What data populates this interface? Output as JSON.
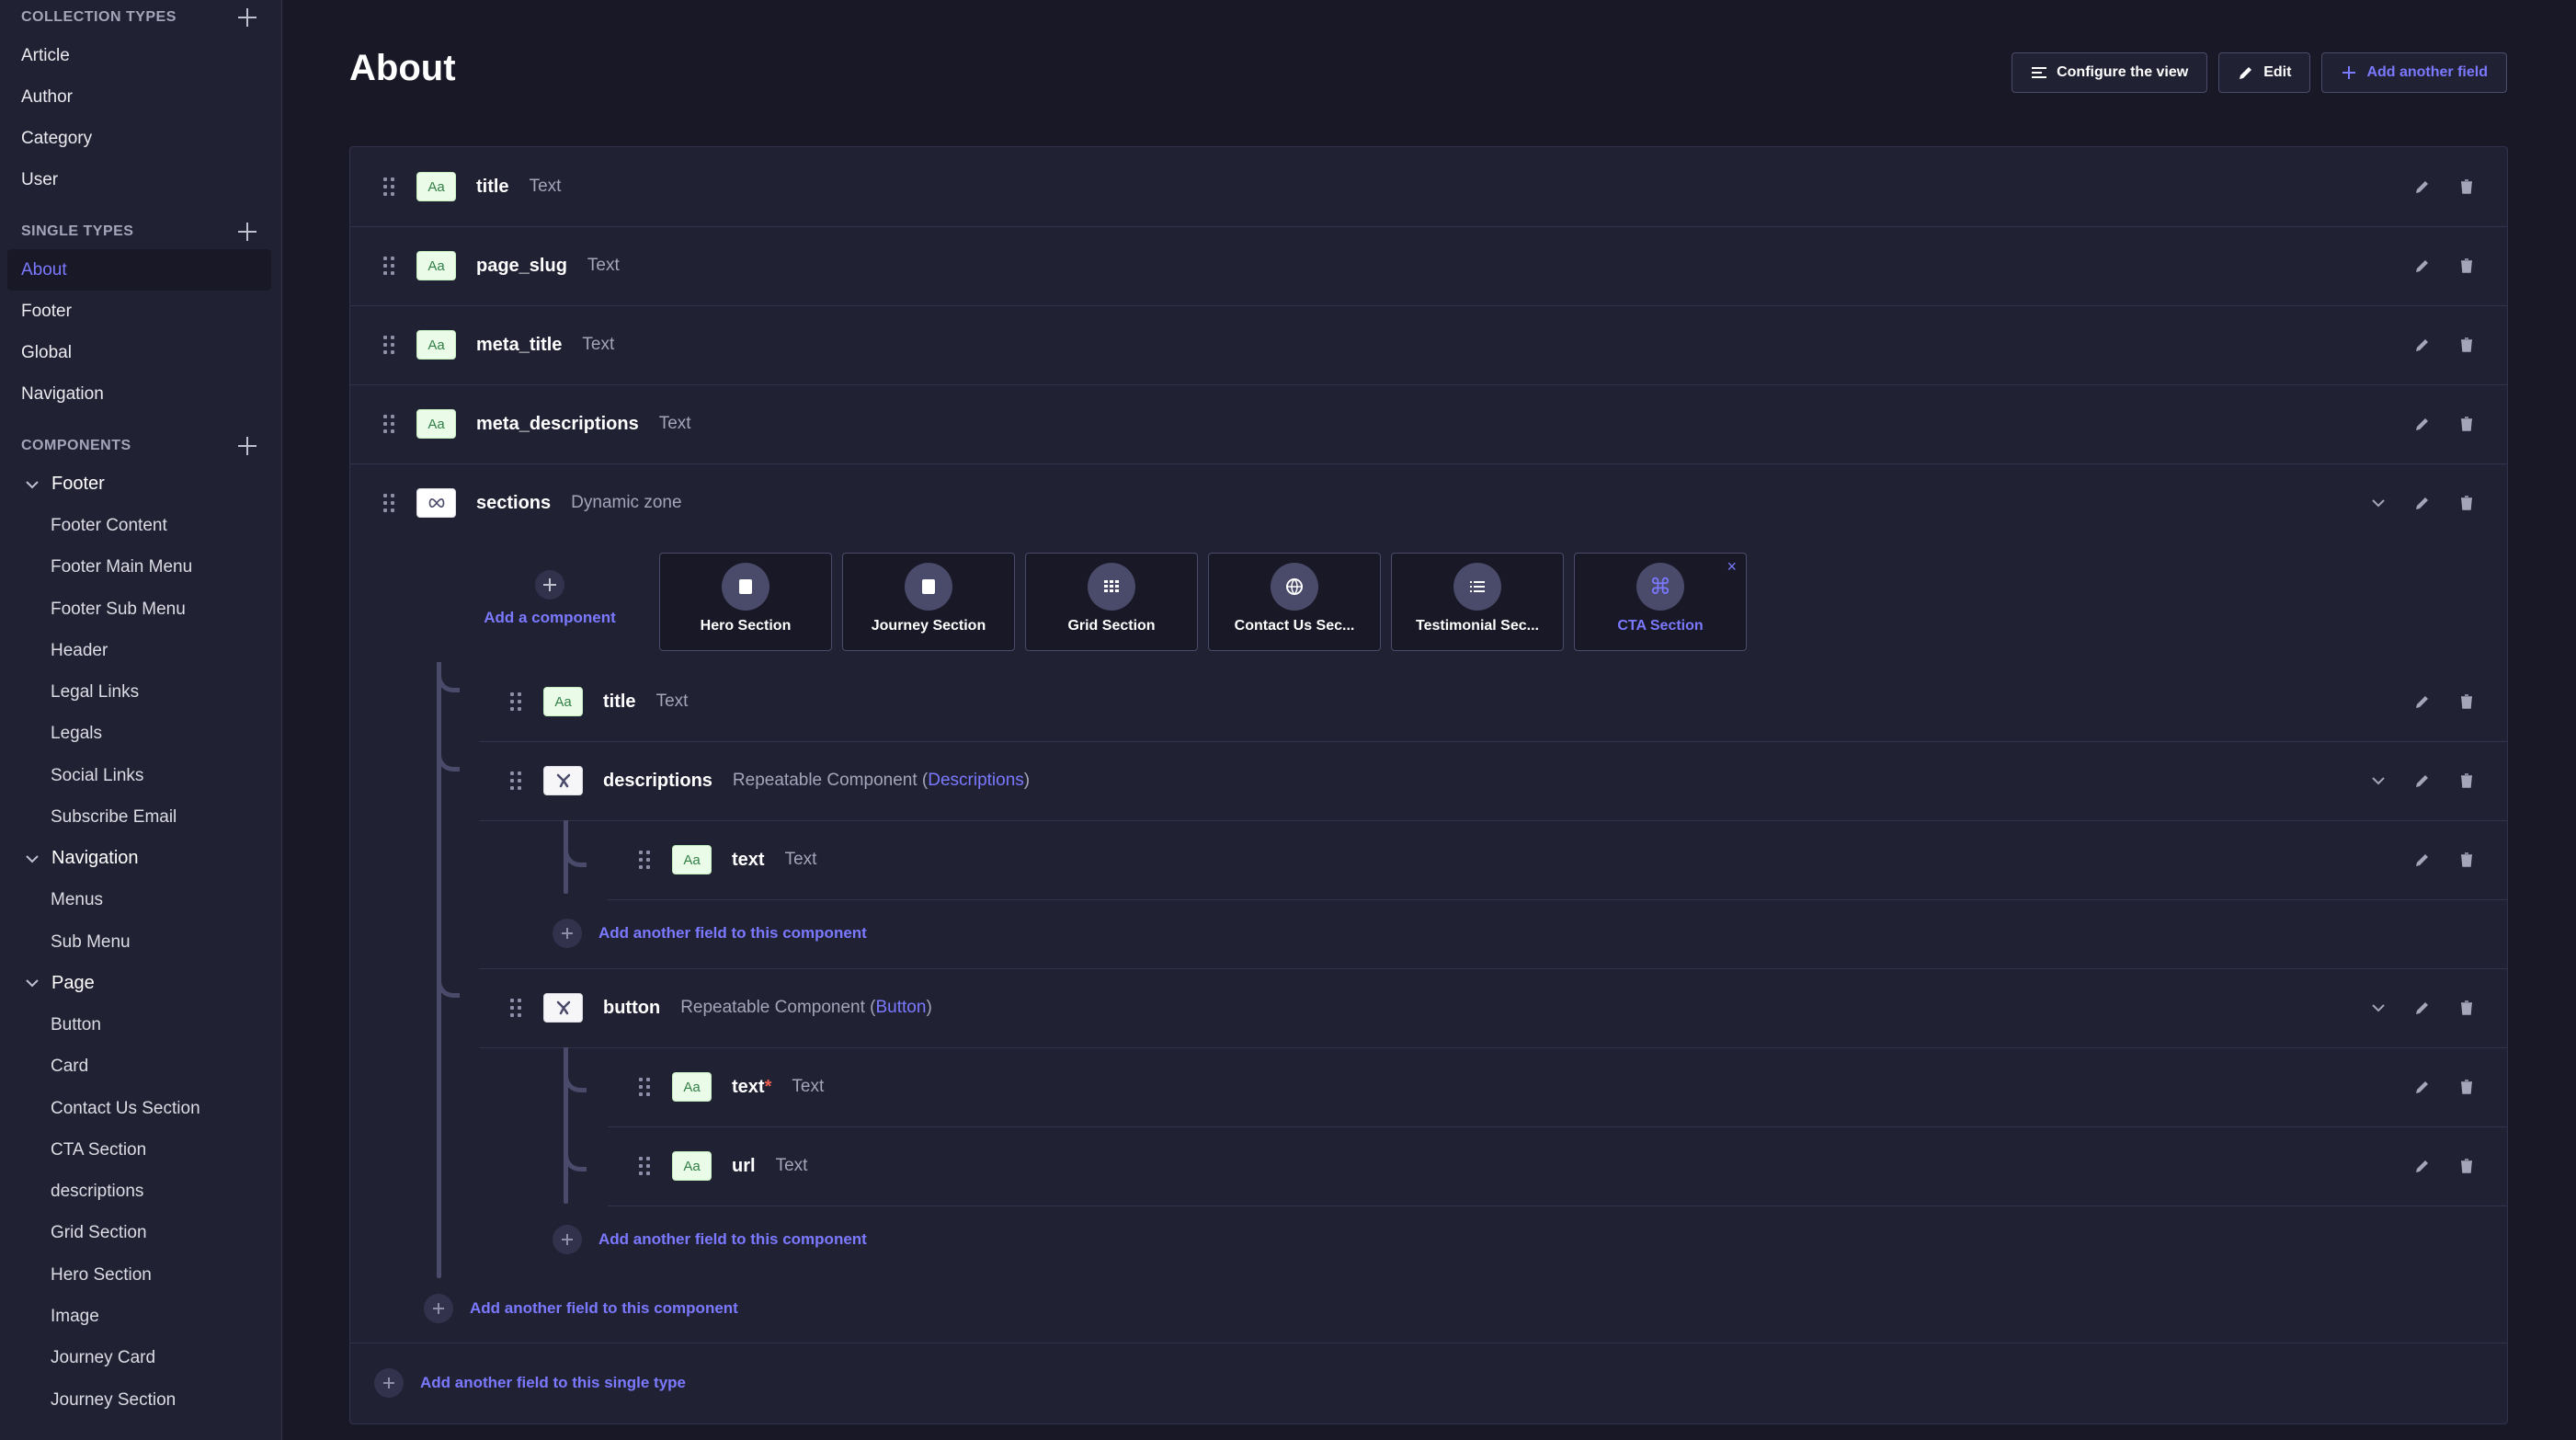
{
  "sidebar": {
    "collection_types_label": "COLLECTION TYPES",
    "collection_types": [
      "Article",
      "Author",
      "Category",
      "User"
    ],
    "single_types_label": "SINGLE TYPES",
    "single_types": [
      "About",
      "Footer",
      "Global",
      "Navigation"
    ],
    "active_single": "About",
    "components_label": "COMPONENTS",
    "groups": [
      {
        "name": "Footer",
        "items": [
          "Footer Content",
          "Footer Main Menu",
          "Footer Sub Menu",
          "Header",
          "Legal Links",
          "Legals",
          "Social Links",
          "Subscribe Email"
        ]
      },
      {
        "name": "Navigation",
        "items": [
          "Menus",
          "Sub Menu"
        ]
      },
      {
        "name": "Page",
        "items": [
          "Button",
          "Card",
          "Contact Us Section",
          "CTA Section",
          "descriptions",
          "Grid Section",
          "Hero Section",
          "Image",
          "Journey Card",
          "Journey Section"
        ]
      }
    ]
  },
  "header": {
    "title": "About",
    "configure_label": "Configure the view",
    "edit_label": "Edit",
    "add_field_label": "Add another field"
  },
  "fields": [
    {
      "name": "title",
      "type": "Text",
      "badge": "Aa"
    },
    {
      "name": "page_slug",
      "type": "Text",
      "badge": "Aa"
    },
    {
      "name": "meta_title",
      "type": "Text",
      "badge": "Aa"
    },
    {
      "name": "meta_descriptions",
      "type": "Text",
      "badge": "Aa"
    },
    {
      "name": "sections",
      "type": "Dynamic zone"
    }
  ],
  "dynamic_zone": {
    "add_component_label": "Add a component",
    "components": [
      {
        "label": "Hero Section",
        "icon": "book-icon"
      },
      {
        "label": "Journey Section",
        "icon": "book-icon"
      },
      {
        "label": "Grid Section",
        "icon": "grid-icon"
      },
      {
        "label": "Contact Us Sec...",
        "icon": "globe-icon"
      },
      {
        "label": "Testimonial Sec...",
        "icon": "list-icon"
      },
      {
        "label": "CTA Section",
        "icon": "command-icon",
        "active": true,
        "close": "×"
      }
    ],
    "cta_fields": [
      {
        "name": "title",
        "type": "Text"
      },
      {
        "name": "descriptions",
        "type_prefix": "Repeatable Component (",
        "type_link": "Descriptions",
        "type_suffix": ")"
      },
      {
        "name": "button",
        "type_prefix": "Repeatable Component (",
        "type_link": "Button",
        "type_suffix": ")"
      }
    ],
    "descriptions_fields": [
      {
        "name": "text",
        "type": "Text"
      }
    ],
    "button_fields": [
      {
        "name": "text",
        "required": "*",
        "type": "Text"
      },
      {
        "name": "url",
        "type": "Text"
      }
    ],
    "add_to_component_label": "Add another field to this component"
  },
  "footer": {
    "add_single_type_label": "Add another field to this single type"
  }
}
